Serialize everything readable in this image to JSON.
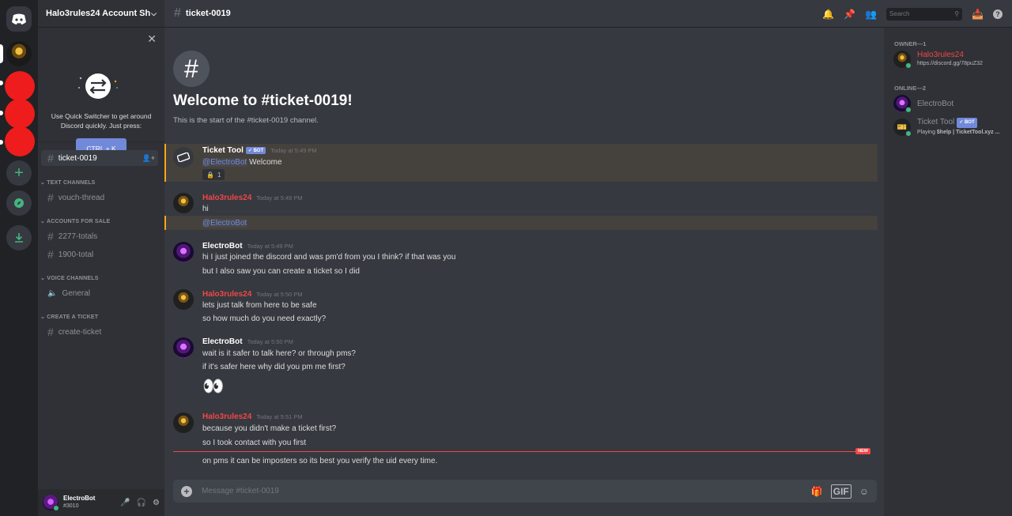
{
  "rail": {
    "home_icon": "discord-logo-icon",
    "add_icon": "plus-icon",
    "explore_icon": "compass-icon",
    "download_icon": "download-icon"
  },
  "sidebar": {
    "guild_name": "Halo3rules24 Account Sh...",
    "quick_switcher": {
      "text": "Use Quick Switcher to get around Discord quickly. Just press:",
      "shortcut": "CTRL + K"
    },
    "selected_channel": "ticket-0019",
    "categories": [
      {
        "name": "TEXT CHANNELS",
        "channels": [
          "vouch-thread"
        ]
      },
      {
        "name": "ACCOUNTS FOR SALE",
        "channels": [
          "2277-totals",
          "1900-total"
        ]
      },
      {
        "name": "VOICE CHANNELS",
        "channels": [
          "General"
        ]
      },
      {
        "name": "CREATE A TICKET",
        "channels": [
          "create-ticket"
        ]
      }
    ],
    "user": {
      "name": "ElectroBot",
      "discriminator": "#3010"
    }
  },
  "header": {
    "channel": "ticket-0019",
    "search_placeholder": "Search"
  },
  "welcome": {
    "title": "Welcome to #ticket-0019!",
    "subtitle": "This is the start of the #ticket-0019 channel."
  },
  "messages": [
    {
      "author": "Ticket Tool",
      "bot": "BOT",
      "time": "Today at 5:49 PM",
      "mention": "@ElectroBot",
      "text": " Welcome",
      "reaction": "1"
    },
    {
      "author": "Halo3rules24",
      "time": "Today at 5:49 PM",
      "lines": [
        "hi"
      ],
      "mention_line": "@ElectroBot"
    },
    {
      "author": "ElectroBot",
      "time": "Today at 5:49 PM",
      "lines": [
        "hi I just joined the discord and was pm'd from you I think? if that was you",
        "but I also saw you can create a ticket so I did"
      ]
    },
    {
      "author": "Halo3rules24",
      "time": "Today at 5:50 PM",
      "lines": [
        "lets just talk from here to be safe",
        "so how much do you need exactly?"
      ]
    },
    {
      "author": "ElectroBot",
      "time": "Today at 5:50 PM",
      "lines": [
        "wait is it safer to talk here? or through pms?",
        "if it's safer here why did you pm me first?"
      ],
      "emoji": "👀"
    },
    {
      "author": "Halo3rules24",
      "time": "Today at 5:51 PM",
      "lines": [
        "because you didn't make a ticket first?",
        "so I took contact with you first"
      ]
    }
  ],
  "new_divider": "NEW",
  "after_new": "on pms it can be imposters so its best you verify the uid every time.",
  "composer": {
    "placeholder": "Message #ticket-0019",
    "gif": "GIF"
  },
  "members": {
    "owner_header": "OWNER—1",
    "owner": {
      "name": "Halo3rules24",
      "status": "https://discord.gg/78puZ32"
    },
    "online_header": "ONLINE—2",
    "online": [
      {
        "name": "ElectroBot",
        "status": ""
      },
      {
        "name": "Ticket Tool",
        "bot": "BOT",
        "status_prefix": "Playing ",
        "status_bold": "$help | TicketTool.xyz ..."
      }
    ]
  },
  "colors": {
    "accent": "#7289da",
    "owner_red": "#f04747",
    "online": "#43b581",
    "mention_bar": "#faa61a"
  }
}
